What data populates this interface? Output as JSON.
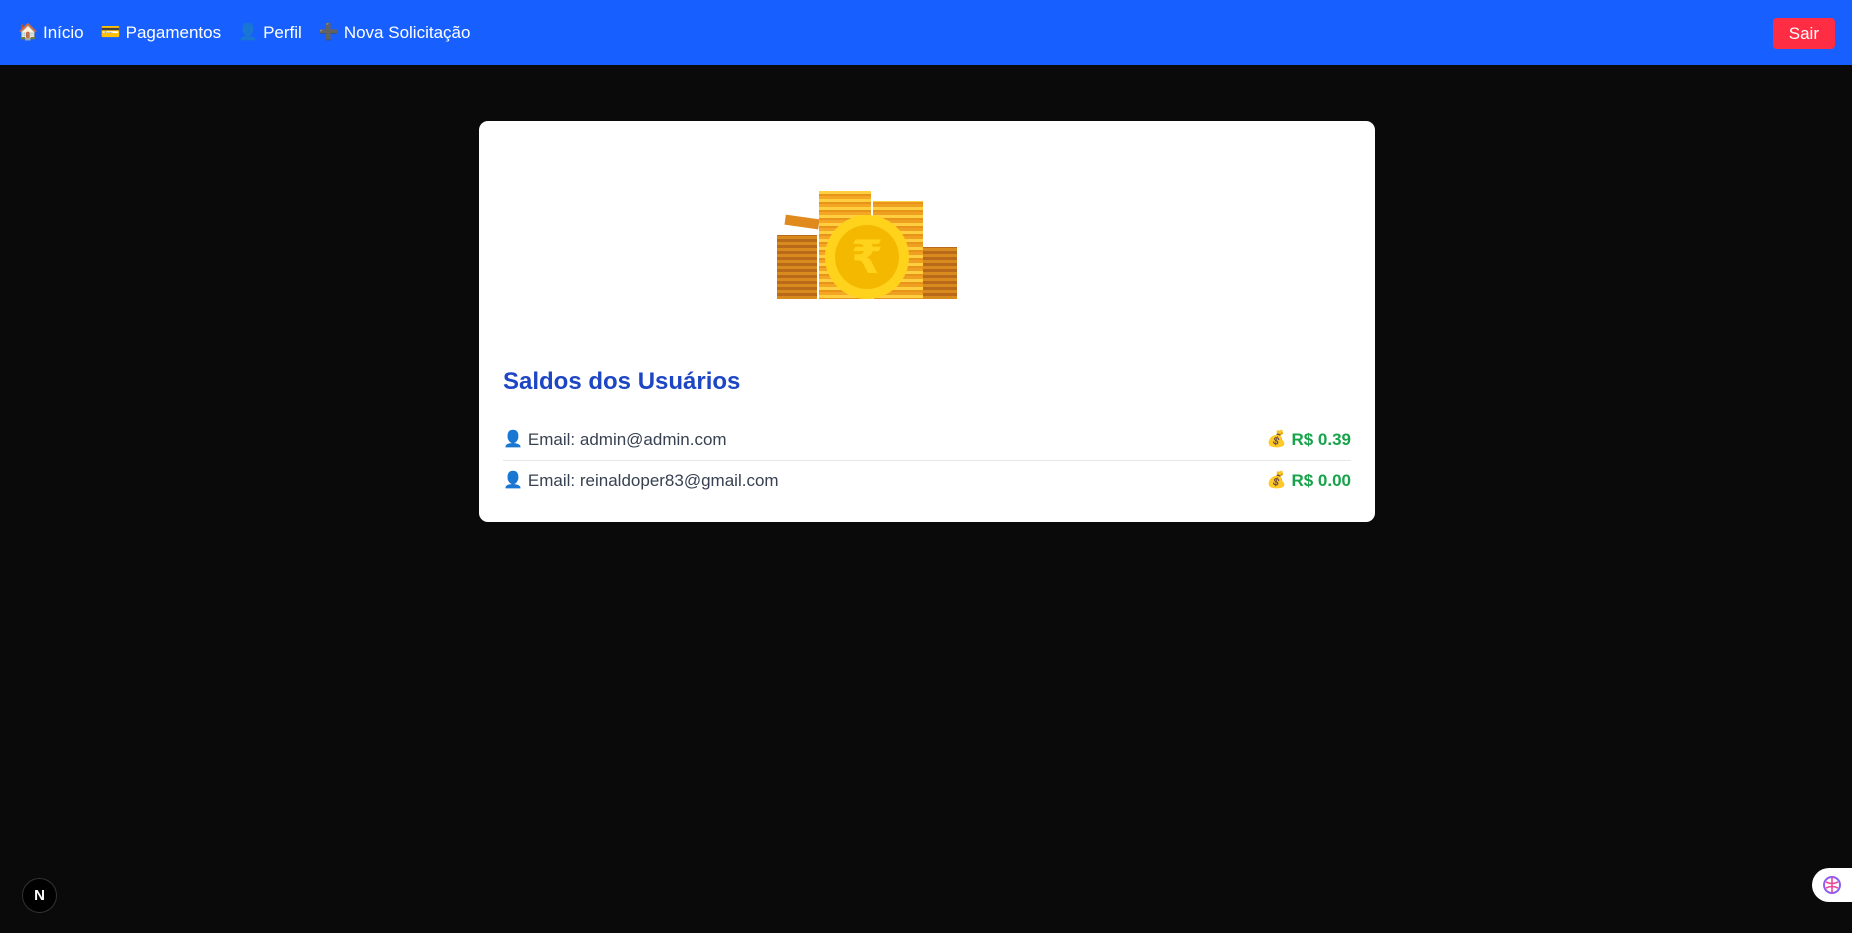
{
  "nav": {
    "items": [
      {
        "icon": "house-icon",
        "glyph": "🏠",
        "label": "Início"
      },
      {
        "icon": "credit-card-icon",
        "glyph": "💳",
        "label": "Pagamentos"
      },
      {
        "icon": "user-icon",
        "glyph": "👤",
        "label": "Perfil"
      },
      {
        "icon": "plus-icon",
        "glyph": "➕",
        "label": "Nova Solicitação"
      }
    ],
    "logout_label": "Sair"
  },
  "card": {
    "image": "coin-stack-illustration",
    "currency_symbol": "₹",
    "title": "Saldos dos Usuários",
    "rows": [
      {
        "icon": "user-icon",
        "glyph": "👤",
        "email_label": "Email: admin@admin.com",
        "amount_icon": "money-bag-icon",
        "amount_glyph": "💰",
        "amount": "R$ 0.39"
      },
      {
        "icon": "user-icon",
        "glyph": "👤",
        "email_label": "Email: reinaldoper83@gmail.com",
        "amount_icon": "money-bag-icon",
        "amount_glyph": "💰",
        "amount": "R$ 0.00"
      }
    ]
  },
  "overlay": {
    "next_badge": "N",
    "side_tab_icon": "brain-icon"
  },
  "colors": {
    "topbar": "#1760ff",
    "background": "#0a0a0a",
    "logout": "#ff2d43",
    "title": "#1d46c4",
    "amount": "#16a34a"
  }
}
